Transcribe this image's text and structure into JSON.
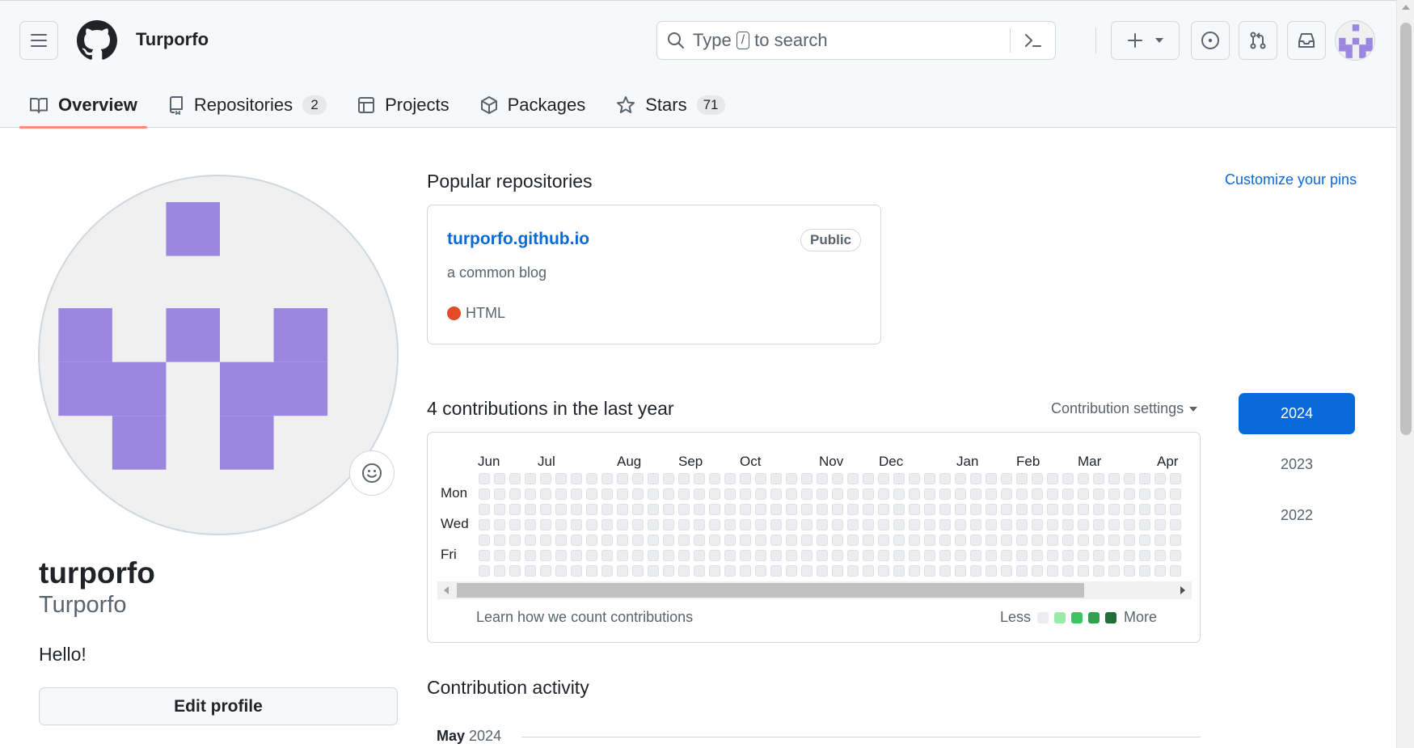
{
  "header": {
    "owner": "Turporfo",
    "search": {
      "pre": "Type",
      "key": "/",
      "post": "to search"
    }
  },
  "tabs": [
    {
      "label": "Overview",
      "active": true
    },
    {
      "label": "Repositories",
      "count": "2"
    },
    {
      "label": "Projects"
    },
    {
      "label": "Packages"
    },
    {
      "label": "Stars",
      "count": "71"
    }
  ],
  "profile": {
    "login": "turporfo",
    "name": "Turporfo",
    "bio": "Hello!",
    "edit_label": "Edit profile",
    "avatar_color": "#9b87e0"
  },
  "popular": {
    "title": "Popular repositories",
    "customize": "Customize your pins",
    "repo": {
      "name": "turporfo.github.io",
      "visibility": "Public",
      "description": "a common blog",
      "language": "HTML",
      "language_color": "#e34c26"
    }
  },
  "contributions": {
    "title": "4 contributions in the last year",
    "settings": "Contribution settings",
    "months": [
      "Jun",
      "Jul",
      "Aug",
      "Sep",
      "Oct",
      "Nov",
      "Dec",
      "Jan",
      "Feb",
      "Mar",
      "Apr"
    ],
    "days": [
      "Mon",
      "Wed",
      "Fri"
    ],
    "learn": "Learn how we count contributions",
    "less": "Less",
    "more": "More",
    "legend_colors": [
      "#ebedf0",
      "#9be9a8",
      "#40c463",
      "#30a14e",
      "#216e39"
    ]
  },
  "years": [
    {
      "label": "2024",
      "active": true
    },
    {
      "label": "2023"
    },
    {
      "label": "2022"
    }
  ],
  "activity": {
    "title": "Contribution activity",
    "month": "May",
    "year": "2024"
  }
}
